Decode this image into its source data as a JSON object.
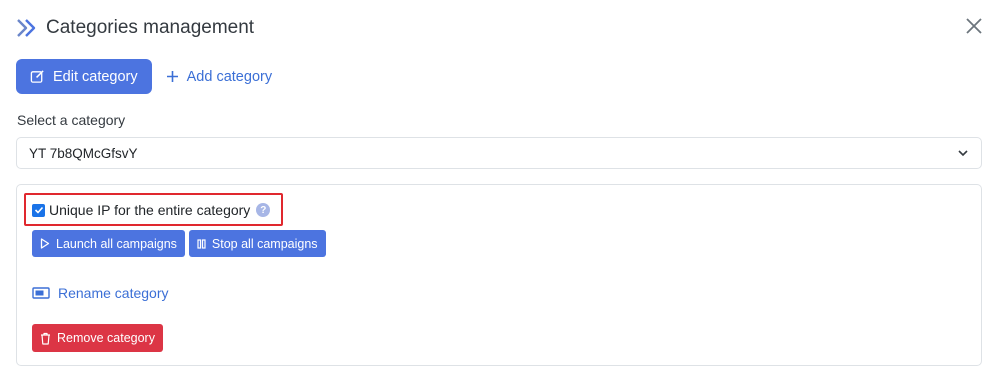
{
  "header": {
    "title": "Categories management",
    "logo_icon": "double-chevron-right-icon",
    "close_icon": "close-icon"
  },
  "tabs": {
    "edit_label": "Edit category",
    "add_label": "Add category"
  },
  "select": {
    "label": "Select a category",
    "value": "YT 7b8QMcGfsvY"
  },
  "panel": {
    "unique_ip_label": "Unique IP for the entire category",
    "unique_ip_checked": true,
    "help_glyph": "?",
    "launch_label": "Launch all campaigns",
    "stop_label": "Stop all campaigns",
    "rename_label": "Rename category",
    "remove_label": "Remove category"
  },
  "colors": {
    "primary": "#4c74e0",
    "link": "#3b6fd6",
    "danger": "#dc3545",
    "highlight": "#e0282e"
  }
}
